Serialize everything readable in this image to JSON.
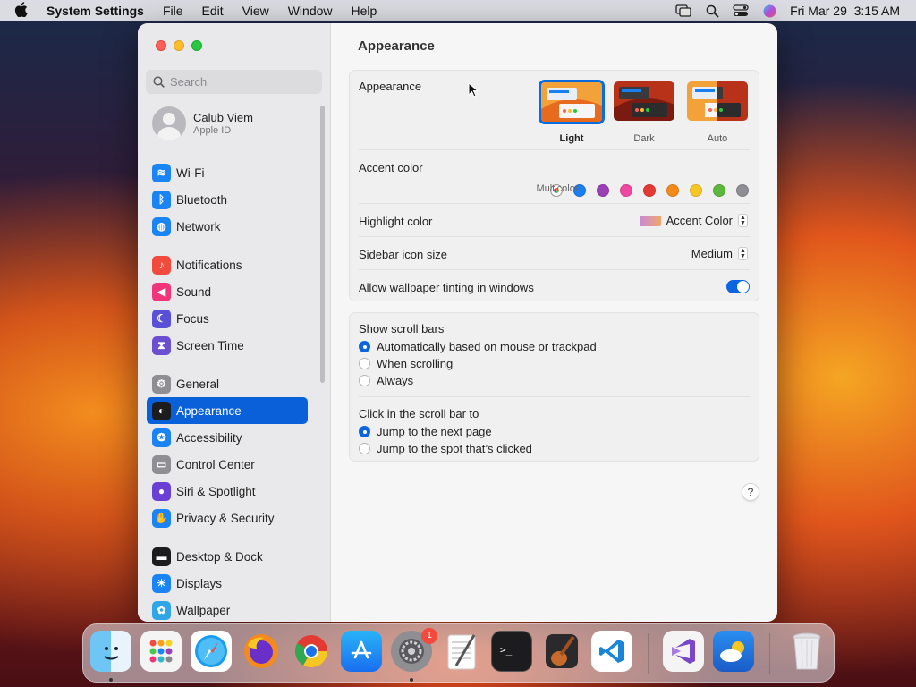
{
  "menubar": {
    "app": "System Settings",
    "items": [
      "File",
      "Edit",
      "View",
      "Window",
      "Help"
    ],
    "clock": "Fri Mar 29  3:15 AM"
  },
  "window": {
    "title": "Appearance"
  },
  "sidebar": {
    "search_placeholder": "Search",
    "profile": {
      "name": "Calub Viem",
      "sub": "Apple ID"
    },
    "groups": [
      [
        {
          "label": "Wi-Fi",
          "icon": "wifi-icon",
          "color": "#1a84f5"
        },
        {
          "label": "Bluetooth",
          "icon": "bluetooth-icon",
          "color": "#1a84f5"
        },
        {
          "label": "Network",
          "icon": "globe-icon",
          "color": "#1a84f5"
        }
      ],
      [
        {
          "label": "Notifications",
          "icon": "bell-icon",
          "color": "#f24a3d"
        },
        {
          "label": "Sound",
          "icon": "speaker-icon",
          "color": "#f0357a"
        },
        {
          "label": "Focus",
          "icon": "moon-icon",
          "color": "#5a50d8"
        },
        {
          "label": "Screen Time",
          "icon": "hourglass-icon",
          "color": "#6a4fd0"
        }
      ],
      [
        {
          "label": "General",
          "icon": "gear-icon",
          "color": "#8e8e93"
        },
        {
          "label": "Appearance",
          "icon": "appearance-icon",
          "color": "#1c1c1e",
          "selected": true
        },
        {
          "label": "Accessibility",
          "icon": "accessibility-icon",
          "color": "#1a84f5"
        },
        {
          "label": "Control Center",
          "icon": "switches-icon",
          "color": "#8e8e93"
        },
        {
          "label": "Siri & Spotlight",
          "icon": "siri-icon",
          "color": "#6a3fd6"
        },
        {
          "label": "Privacy & Security",
          "icon": "hand-icon",
          "color": "#1a84f5"
        }
      ],
      [
        {
          "label": "Desktop & Dock",
          "icon": "dock-icon",
          "color": "#1c1c1e"
        },
        {
          "label": "Displays",
          "icon": "sun-icon",
          "color": "#1a84f5"
        },
        {
          "label": "Wallpaper",
          "icon": "flower-icon",
          "color": "#2fa6e8"
        }
      ]
    ]
  },
  "appearance": {
    "label": "Appearance",
    "options": [
      {
        "label": "Light",
        "selected": true
      },
      {
        "label": "Dark"
      },
      {
        "label": "Auto"
      }
    ]
  },
  "accent": {
    "label": "Accent color",
    "selected_name": "Multicolor",
    "colors": [
      "multicolor",
      "#1a7ff0",
      "#9a3fb4",
      "#f047a0",
      "#e33a34",
      "#f48a1c",
      "#f6c724",
      "#5bb83d",
      "#8e8e93"
    ]
  },
  "highlight": {
    "label": "Highlight color",
    "value": "Accent Color"
  },
  "sidebar_icon": {
    "label": "Sidebar icon size",
    "value": "Medium"
  },
  "tinting": {
    "label": "Allow wallpaper tinting in windows",
    "on": true
  },
  "scrollbars": {
    "label": "Show scroll bars",
    "options": [
      "Automatically based on mouse or trackpad",
      "When scrolling",
      "Always"
    ],
    "selected": 0
  },
  "click_scroll": {
    "label": "Click in the scroll bar to",
    "options": [
      "Jump to the next page",
      "Jump to the spot that’s clicked"
    ],
    "selected": 0
  },
  "help": "?",
  "dock": {
    "badge": "1"
  }
}
